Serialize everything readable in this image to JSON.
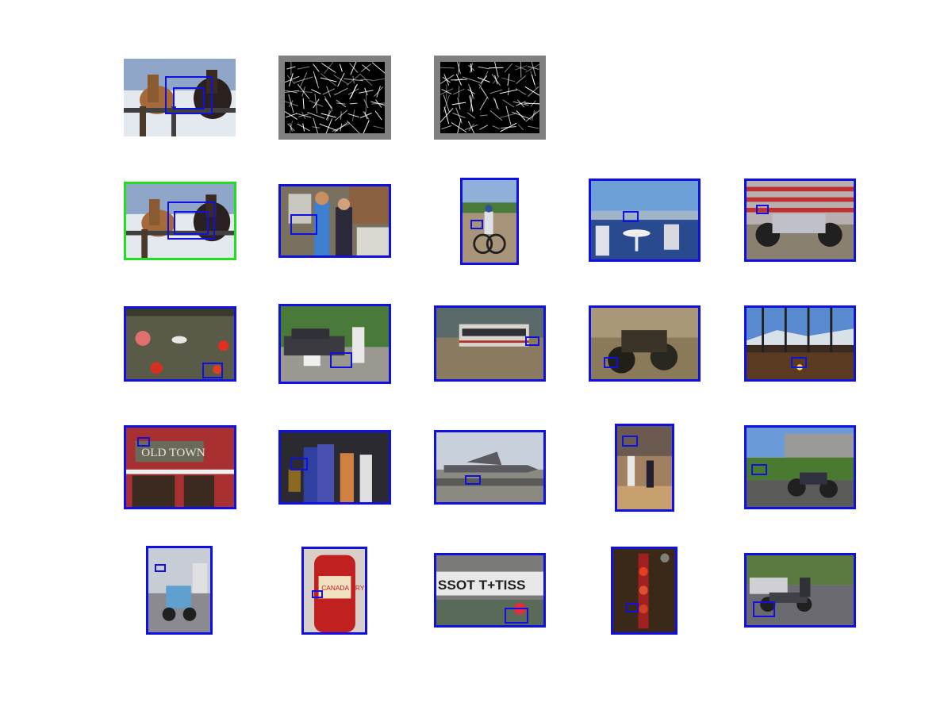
{
  "figure": {
    "colors": {
      "detection": "#1010e0",
      "query": "#22dd22",
      "hog_frame": "#808080",
      "hog_background": "#000000"
    },
    "rows": [
      [
        {
          "kind": "photo-plain",
          "theme": "horses-snow",
          "boxes": 2
        },
        {
          "kind": "hog",
          "theme": "hog-descriptor"
        },
        {
          "kind": "hog",
          "theme": "hog-descriptor-alt"
        }
      ],
      [
        {
          "kind": "photo-query",
          "theme": "horses-snow",
          "boxes": 2
        },
        {
          "kind": "photo",
          "theme": "kitchen-people",
          "boxes": 1
        },
        {
          "kind": "photo",
          "theme": "cyclist",
          "boxes": 1
        },
        {
          "kind": "photo",
          "theme": "deck-tables",
          "boxes": 1
        },
        {
          "kind": "photo",
          "theme": "motorcycle-silver",
          "boxes": 1
        }
      ],
      [
        {
          "kind": "photo",
          "theme": "pond-swan",
          "boxes": 1
        },
        {
          "kind": "photo",
          "theme": "car-dogs",
          "boxes": 1
        },
        {
          "kind": "photo",
          "theme": "bus-field",
          "boxes": 1
        },
        {
          "kind": "photo",
          "theme": "motorcycle-sepia",
          "boxes": 1
        },
        {
          "kind": "photo",
          "theme": "window-mountains",
          "boxes": 1
        }
      ],
      [
        {
          "kind": "photo",
          "theme": "old-town-sign",
          "boxes": 1
        },
        {
          "kind": "photo",
          "theme": "costume-party",
          "boxes": 1
        },
        {
          "kind": "photo",
          "theme": "fighter-jet",
          "boxes": 1
        },
        {
          "kind": "photo",
          "theme": "basketball-gym",
          "boxes": 1
        },
        {
          "kind": "photo",
          "theme": "motorcycle-lawn",
          "boxes": 1
        }
      ],
      [
        {
          "kind": "photo",
          "theme": "scooter-street",
          "boxes": 1
        },
        {
          "kind": "photo",
          "theme": "soda-bottle",
          "boxes": 1
        },
        {
          "kind": "photo",
          "theme": "banner-race",
          "boxes": 1
        },
        {
          "kind": "photo",
          "theme": "lantern-tree",
          "boxes": 1
        },
        {
          "kind": "photo",
          "theme": "motorcycle-parking",
          "boxes": 1
        }
      ]
    ],
    "signs": {
      "old_town": "OLD TOWN",
      "banner": "SSOT  T+TISS",
      "soda": "CANADA DRY"
    }
  }
}
